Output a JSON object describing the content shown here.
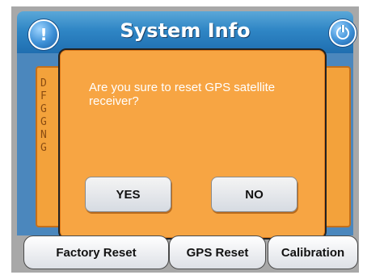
{
  "header": {
    "title": "System Info",
    "info_icon": "exclamation-icon",
    "power_icon": "power-icon",
    "info_glyph": "!"
  },
  "background_panel": {
    "visible_initials": [
      "D",
      "F",
      "G",
      "G",
      "N",
      "G"
    ]
  },
  "dialog": {
    "message": "Are you sure to reset GPS satellite receiver?",
    "yes_label": "YES",
    "no_label": "NO"
  },
  "footer": {
    "factory_reset_label": "Factory Reset",
    "gps_reset_label": "GPS Reset",
    "calibration_label": "Calibration"
  },
  "colors": {
    "title_bar": "#2f86c5",
    "dialog": "#f7a543",
    "panel": "#f3a23b"
  }
}
